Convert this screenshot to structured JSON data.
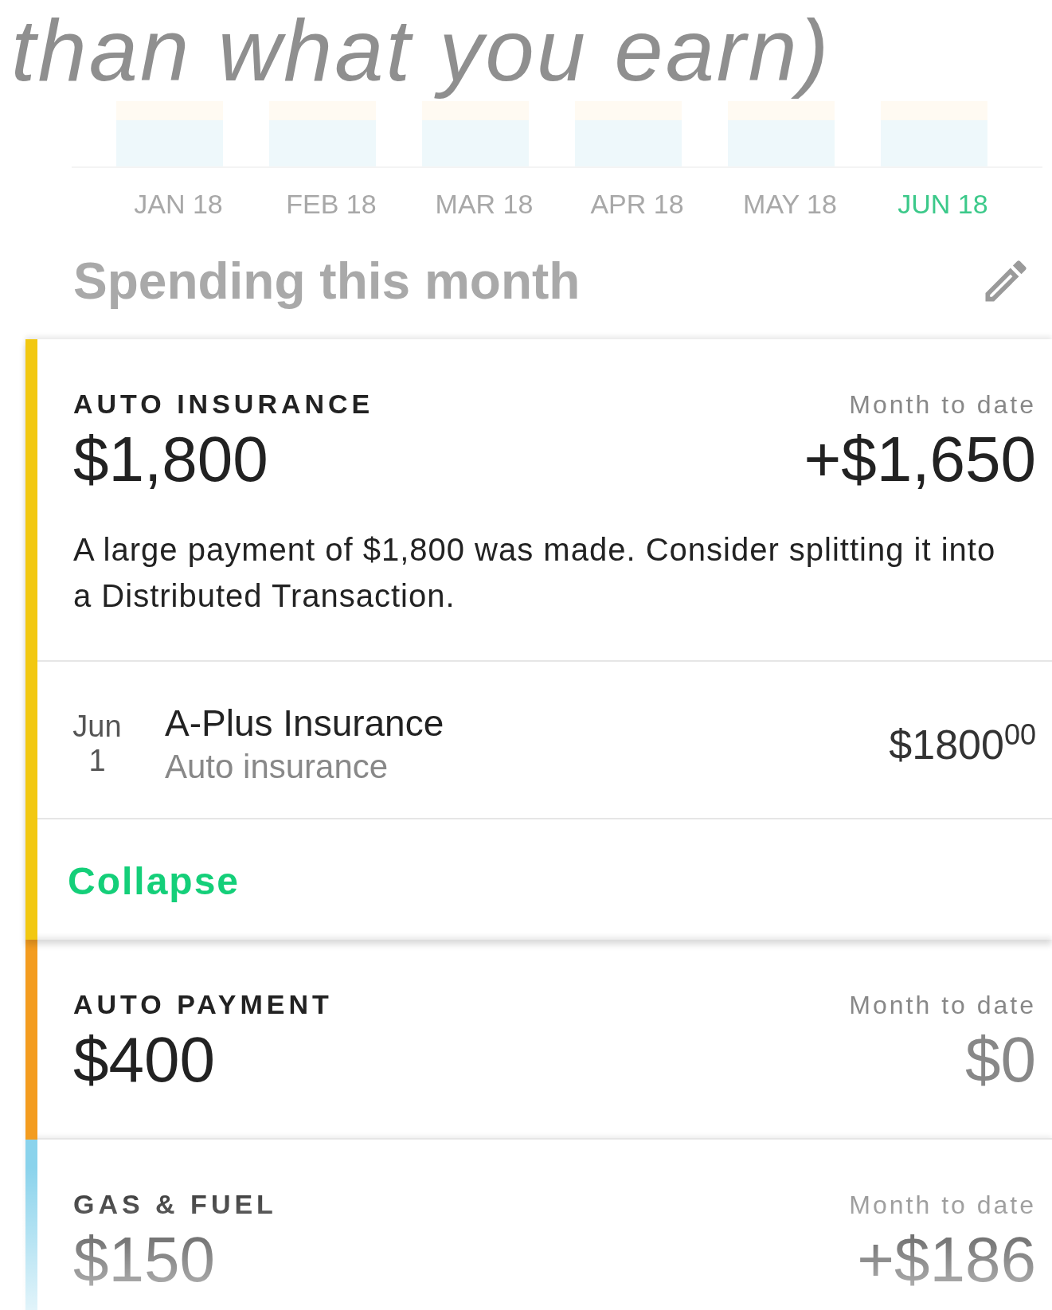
{
  "headline": "than what you earn)",
  "months": [
    {
      "label": "JAN 18",
      "selected": false
    },
    {
      "label": "FEB 18",
      "selected": false
    },
    {
      "label": "MAR 18",
      "selected": false
    },
    {
      "label": "APR 18",
      "selected": false
    },
    {
      "label": "MAY 18",
      "selected": false
    },
    {
      "label": "JUN 18",
      "selected": true
    }
  ],
  "section_title": "Spending this month",
  "categories": [
    {
      "name": "AUTO INSURANCE",
      "amount": "$1,800",
      "mtd_label": "Month to date",
      "mtd_value": "+$1,650",
      "over_budget": true,
      "color": "#f2c811",
      "expanded": true,
      "note": "A large payment of $1,800 was made. Consider splitting it into a Distributed Transaction.",
      "transactions": [
        {
          "month": "Jun",
          "day": "1",
          "merchant": "A-Plus Insurance",
          "category": "Auto insurance",
          "amount": "$1800$^{00}$"
        }
      ],
      "action": "Collapse"
    },
    {
      "name": "AUTO PAYMENT",
      "amount": "$400",
      "mtd_label": "Month to date",
      "mtd_value": "$0",
      "over_budget": false,
      "color": "#f39c1f",
      "expanded": false
    },
    {
      "name": "GAS & FUEL",
      "amount": "$150",
      "mtd_label": "Month to date",
      "mtd_value": "+$186",
      "over_budget": true,
      "color": "#8ad3ec",
      "expanded": false
    }
  ]
}
